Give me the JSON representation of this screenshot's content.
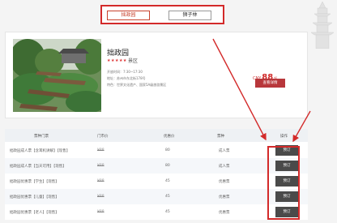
{
  "tabs": [
    {
      "label": "拙政园",
      "active": true
    },
    {
      "label": "狮子林",
      "active": false
    }
  ],
  "card": {
    "title": "拙政园",
    "stars": "★★★★★",
    "level": "景区",
    "open_time": "开放时间：7:30~17:30",
    "address": "地址：苏州市东北街178号",
    "feature": "特色：世界文化遗产、国家5A级旅游景区",
    "price_currency": "CNY",
    "price_value": "88",
    "price_unit": "起",
    "ticket_button": "查看详情"
  },
  "table": {
    "headers": [
      "票种门票",
      "门市价",
      "优惠价",
      "票种",
      "操作"
    ],
    "rows": [
      {
        "name": "拙政园成人票【含耳机讲解】【现售】",
        "list_price": "¥88",
        "sale_price": "80",
        "type": "成人票",
        "action": "预订"
      },
      {
        "name": "拙政园成人票【当天可用】【现售】",
        "list_price": "¥88",
        "sale_price": "80",
        "type": "成人票",
        "action": "预订"
      },
      {
        "name": "拙政园优惠票【学生】【现售】",
        "list_price": "¥88",
        "sale_price": "45",
        "type": "优惠票",
        "action": "预订"
      },
      {
        "name": "拙政园优惠票【儿童】【现售】",
        "list_price": "¥88",
        "sale_price": "45",
        "type": "优惠票",
        "action": "预订"
      },
      {
        "name": "拙政园优惠票【老人】【现售】",
        "list_price": "¥88",
        "sale_price": "45",
        "type": "优惠票",
        "action": "预订"
      }
    ]
  },
  "colors": {
    "annotation_red": "#d32a2a",
    "price_red": "#d02a2a",
    "button_dark": "#4a4a4a",
    "button_red": "#b8373b"
  }
}
